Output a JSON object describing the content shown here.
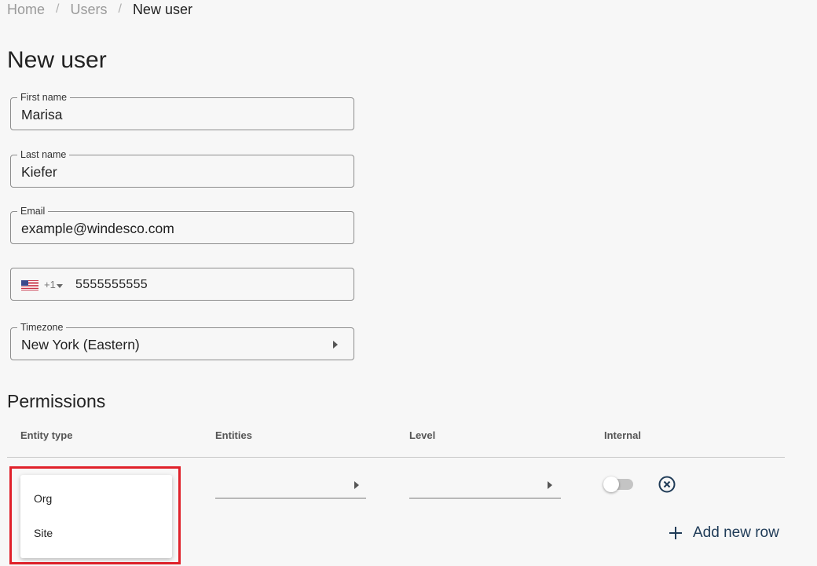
{
  "breadcrumb": {
    "home": "Home",
    "separator": "/",
    "users": "Users",
    "current": "New user"
  },
  "page_title": "New user",
  "form": {
    "first_name": {
      "label": "First name",
      "value": "Marisa"
    },
    "last_name": {
      "label": "Last name",
      "value": "Kiefer"
    },
    "email": {
      "label": "Email",
      "value": "example@windesco.com"
    },
    "phone": {
      "country_code": "+1",
      "flag_icon": "us-flag-icon",
      "value": "5555555555"
    },
    "timezone": {
      "label": "Timezone",
      "value": "New York (Eastern)"
    }
  },
  "permissions": {
    "title": "Permissions",
    "columns": [
      "Entity type",
      "Entities",
      "Level",
      "Internal"
    ],
    "row": {
      "internal_toggle_on": false
    },
    "entity_type_options": [
      "Org",
      "Site"
    ],
    "add_row_label": "Add new row"
  },
  "colors": {
    "accent": "#1f3b57",
    "highlight": "#e0212a",
    "background": "#f7f7f7"
  }
}
